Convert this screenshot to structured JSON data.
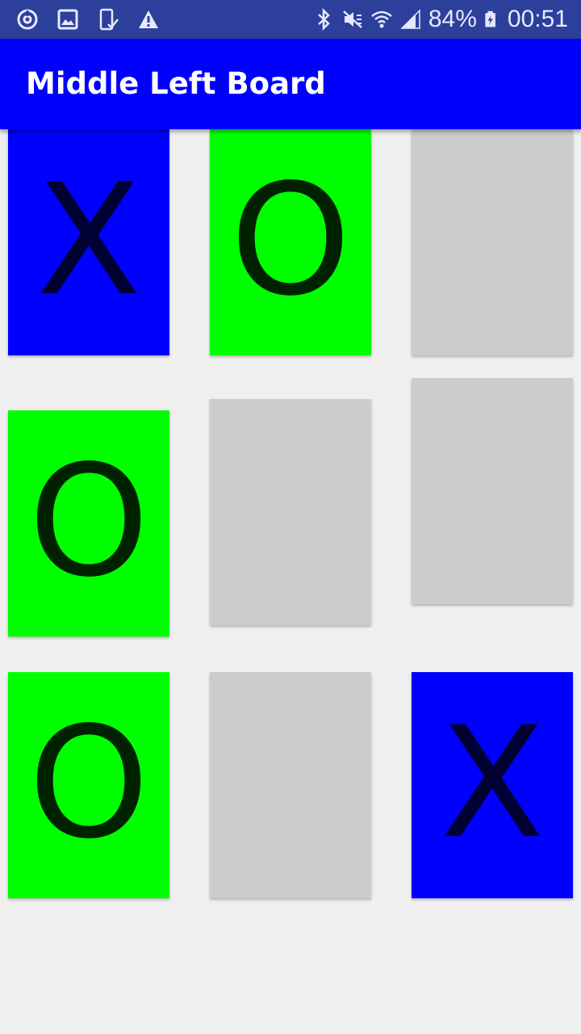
{
  "status_bar": {
    "left_icons": [
      "sync-icon",
      "gallery-icon",
      "phone-check-icon",
      "warning-icon"
    ],
    "right_icons": [
      "bluetooth-icon",
      "mute-icon",
      "wifi-icon",
      "signal-icon",
      "battery-charging-icon"
    ],
    "battery": "84%",
    "time": "00:51"
  },
  "app_bar": {
    "title": "Middle Left Board"
  },
  "board": {
    "cells": [
      {
        "mark": "X",
        "state": "x"
      },
      {
        "mark": "O",
        "state": "o"
      },
      {
        "mark": "",
        "state": "empty"
      },
      {
        "mark": "O",
        "state": "o"
      },
      {
        "mark": "",
        "state": "empty"
      },
      {
        "mark": "",
        "state": "empty"
      },
      {
        "mark": "O",
        "state": "o"
      },
      {
        "mark": "",
        "state": "empty"
      },
      {
        "mark": "X",
        "state": "x"
      }
    ]
  },
  "colors": {
    "status_bar": "#2c3f9b",
    "app_bar": "#0000ff",
    "x_cell": "#0000ff",
    "o_cell": "#00ff00",
    "empty_cell": "#cccccc",
    "background": "#efefef"
  }
}
